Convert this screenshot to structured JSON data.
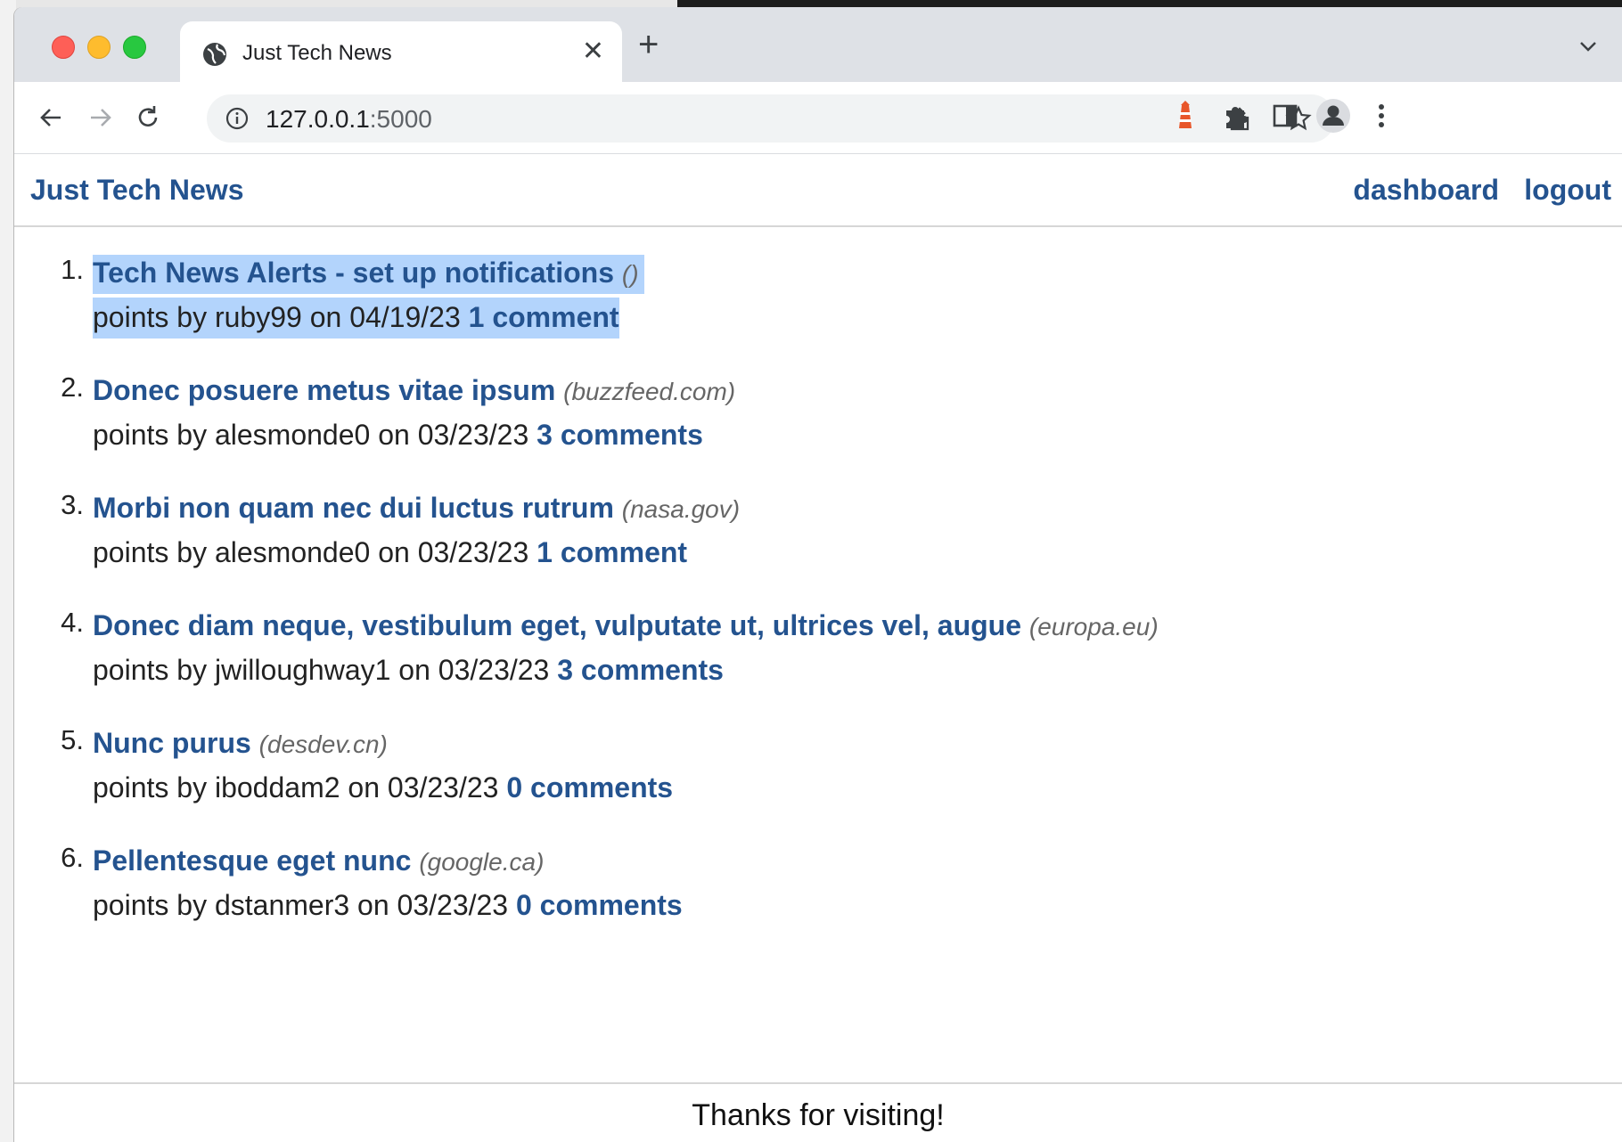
{
  "browser": {
    "tab_title": "Just Tech News",
    "url_host": "127.0.0.1",
    "url_port": ":5000"
  },
  "site": {
    "brand": "Just Tech News",
    "nav": {
      "dashboard": "dashboard",
      "logout": "logout"
    },
    "footer": "Thanks for visiting!"
  },
  "posts": [
    {
      "number": "1.",
      "title": "Tech News Alerts - set up notifications",
      "domain": "()",
      "meta": "points by ruby99 on 04/19/23",
      "comments": "1 comment",
      "selected": true
    },
    {
      "number": "2.",
      "title": "Donec posuere metus vitae ipsum",
      "domain": "(buzzfeed.com)",
      "meta": "points by alesmonde0 on 03/23/23",
      "comments": "3 comments"
    },
    {
      "number": "3.",
      "title": "Morbi non quam nec dui luctus rutrum",
      "domain": "(nasa.gov)",
      "meta": "points by alesmonde0 on 03/23/23",
      "comments": "1 comment"
    },
    {
      "number": "4.",
      "title": "Donec diam neque, vestibulum eget, vulputate ut, ultrices vel, augue",
      "domain": "(europa.eu)",
      "meta": "points by jwilloughway1 on 03/23/23",
      "comments": "3 comments"
    },
    {
      "number": "5.",
      "title": "Nunc purus",
      "domain": "(desdev.cn)",
      "meta": "points by iboddam2 on 03/23/23",
      "comments": "0 comments"
    },
    {
      "number": "6.",
      "title": "Pellentesque eget nunc",
      "domain": "(google.ca)",
      "meta": "points by dstanmer3 on 03/23/23",
      "comments": "0 comments"
    }
  ],
  "colors": {
    "link": "#24538f",
    "selection": "#b3d4fc"
  }
}
